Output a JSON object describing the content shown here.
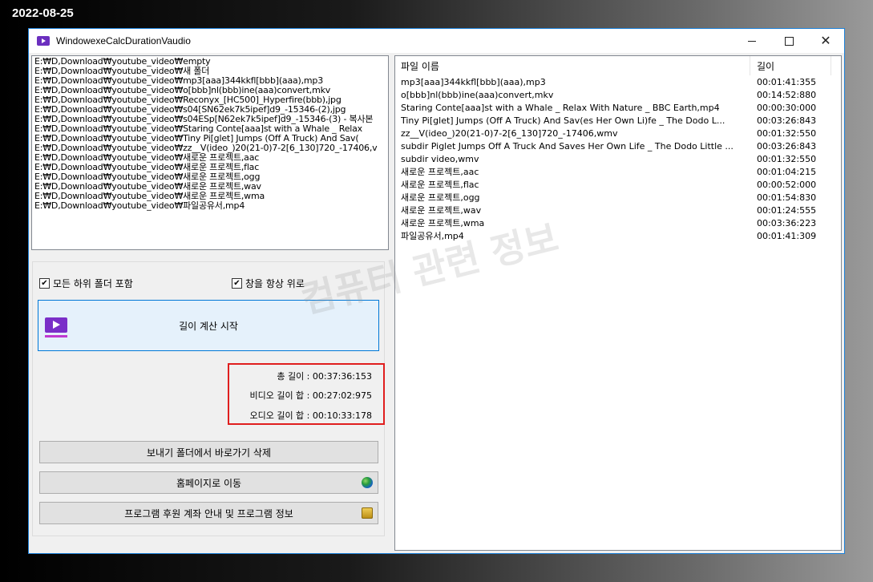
{
  "date_stamp": "2022-08-25",
  "window": {
    "title": "WindowexeCalcDurationVaudio"
  },
  "path_list": [
    "E:₩D,Download₩youtube_video₩empty",
    "E:₩D,Download₩youtube_video₩새 폴더",
    "E:₩D,Download₩youtube_video₩mp3[aaa]344kkfl[bbb](aaa),mp3",
    "E:₩D,Download₩youtube_video₩o[bbb]nl(bbb)ine(aaa)convert,mkv",
    "E:₩D,Download₩youtube_video₩Reconyx_[HC500]_Hyperfire(bbb),jpg",
    "E:₩D,Download₩youtube_video₩s04[SN62ek7k5ipef]d9_-15346-(2),jpg",
    "E:₩D,Download₩youtube_video₩s04ESp[N62ek7k5ipef]d9_-15346-(3) - 복사본",
    "E:₩D,Download₩youtube_video₩Staring Conte[aaa]st with a Whale _ Relax",
    "E:₩D,Download₩youtube_video₩Tiny Pi[glet] Jumps (Off A Truck) And Sav(",
    "E:₩D,Download₩youtube_video₩zz__V(ideo_)20(21-0)7-2[6_130]720_-17406,v",
    "E:₩D,Download₩youtube_video₩새로운 프로젝트,aac",
    "E:₩D,Download₩youtube_video₩새로운 프로젝트,flac",
    "E:₩D,Download₩youtube_video₩새로운 프로젝트,ogg",
    "E:₩D,Download₩youtube_video₩새로운 프로젝트,wav",
    "E:₩D,Download₩youtube_video₩새로운 프로젝트,wma",
    "E:₩D,Download₩youtube_video₩파일공유서,mp4"
  ],
  "options": {
    "include_subfolders_label": "모든 하위 폴더 포함",
    "include_subfolders_checked": true,
    "always_on_top_label": "창을 항상 위로",
    "always_on_top_checked": true
  },
  "start_button_label": "길이 계산 시작",
  "stats": {
    "total": "총 길이 : 00:37:36:153",
    "video": "비디오 길이 합 : 00:27:02:975",
    "audio": "오디오 길이 합 : 00:10:33:178"
  },
  "buttons": {
    "delete_shortcut": "보내기 폴더에서 바로가기 삭제",
    "homepage": "홈페이지로 이동",
    "support_info": "프로그램 후원 계좌 안내 및 프로그램 정보"
  },
  "icons": {
    "homepage": "globe-icon",
    "support_info": "coins-icon"
  },
  "table": {
    "col_name": "파일 이름",
    "col_length": "길이",
    "rows": [
      {
        "name": "mp3[aaa]344kkfl[bbb](aaa),mp3",
        "length": "00:01:41:355"
      },
      {
        "name": "o[bbb]nl(bbb)ine(aaa)convert,mkv",
        "length": "00:14:52:880"
      },
      {
        "name": "Staring Conte[aaa]st with a Whale _ Relax With Nature _ BBC Earth,mp4",
        "length": "00:00:30:000"
      },
      {
        "name": "Tiny Pi[glet] Jumps (Off A Truck) And Sav(es Her Own Li)fe _ The Dodo L...",
        "length": "00:03:26:843"
      },
      {
        "name": "zz__V(ideo_)20(21-0)7-2[6_130]720_-17406,wmv",
        "length": "00:01:32:550"
      },
      {
        "name": "subdir Piglet Jumps Off A Truck And Saves Her Own Life _ The Dodo Little ...",
        "length": "00:03:26:843"
      },
      {
        "name": "subdir video,wmv",
        "length": "00:01:32:550"
      },
      {
        "name": "새로운 프로젝트,aac",
        "length": "00:01:04:215"
      },
      {
        "name": "새로운 프로젝트,flac",
        "length": "00:00:52:000"
      },
      {
        "name": "새로운 프로젝트,ogg",
        "length": "00:01:54:830"
      },
      {
        "name": "새로운 프로젝트,wav",
        "length": "00:01:24:555"
      },
      {
        "name": "새로운 프로젝트,wma",
        "length": "00:03:36:223"
      },
      {
        "name": "파일공유서,mp4",
        "length": "00:01:41:309"
      }
    ]
  },
  "watermark": "컴퓨터 관련 정보",
  "colors": {
    "accent": "#0078d7",
    "stats_border": "#e01e1e",
    "app_icon": "#7a2fc8"
  }
}
